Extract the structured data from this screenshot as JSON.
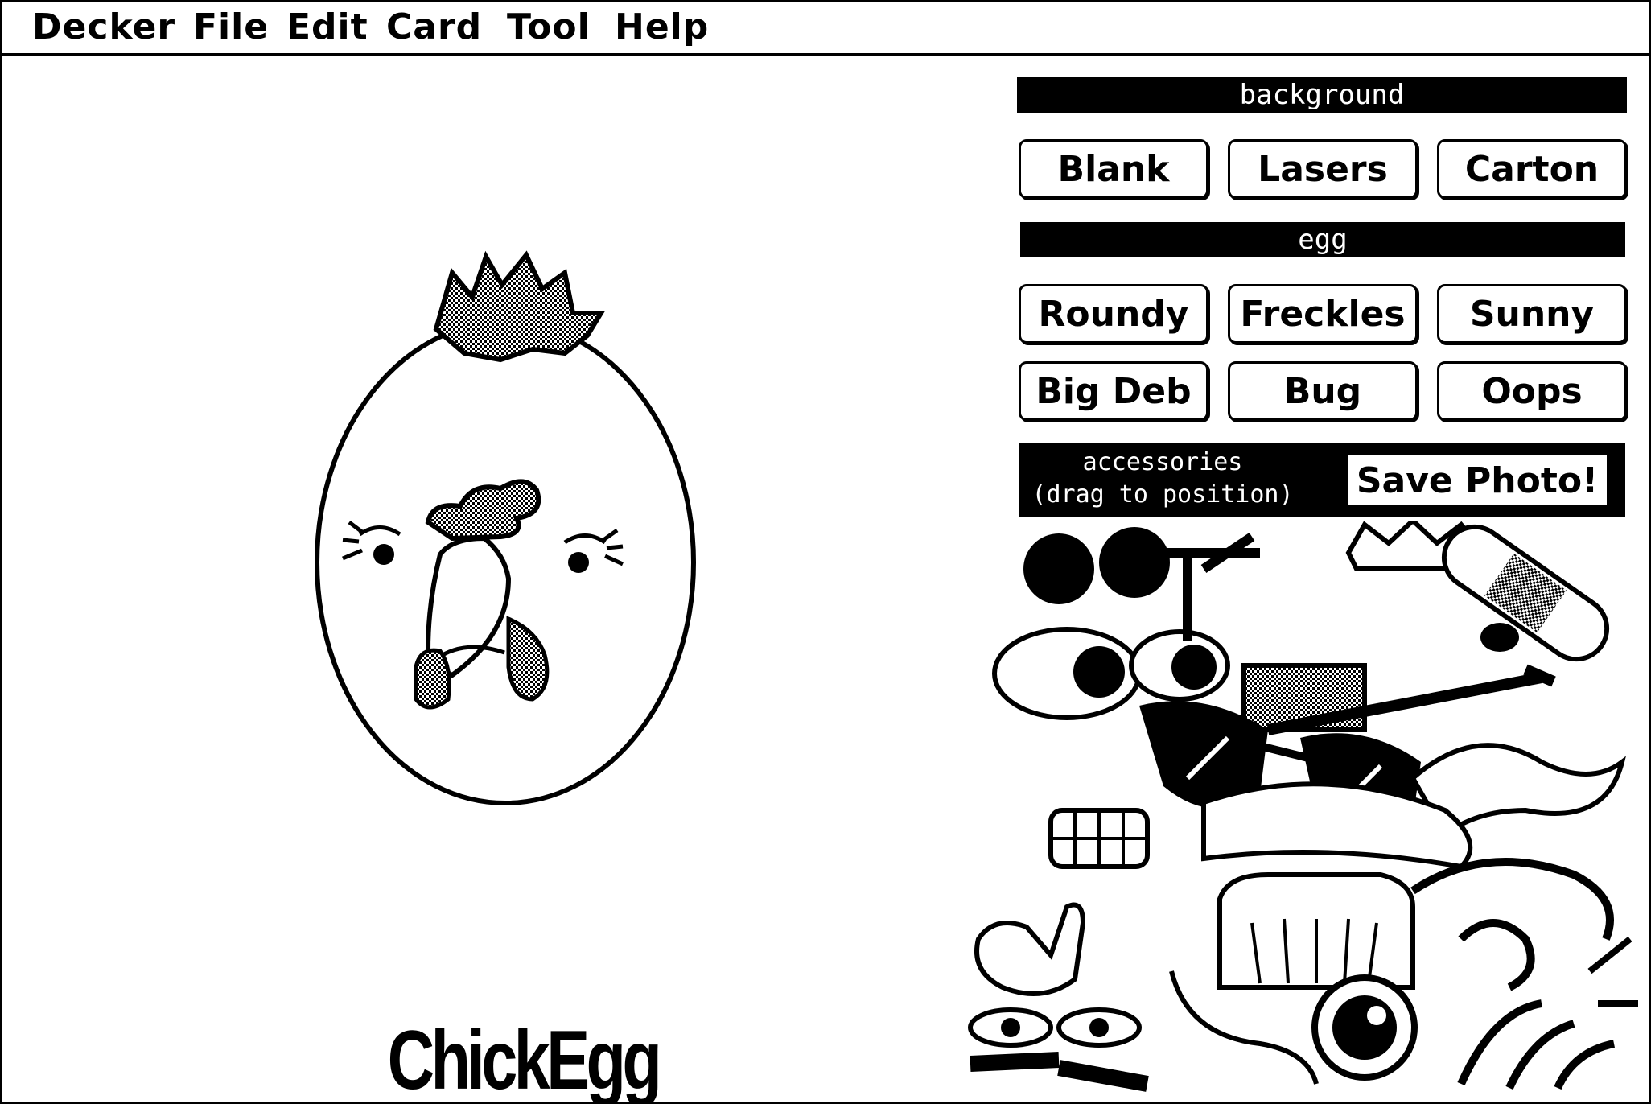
{
  "menubar": {
    "items": [
      "Decker",
      "File",
      "Edit",
      "Card",
      "Tool",
      "Help"
    ]
  },
  "stage": {
    "caption": "ChickEgg"
  },
  "panel": {
    "background_header": "background",
    "background_buttons": [
      "Blank",
      "Lasers",
      "Carton"
    ],
    "egg_header": "egg",
    "egg_buttons": [
      "Roundy",
      "Freckles",
      "Sunny",
      "Big Deb",
      "Bug",
      "Oops"
    ],
    "accessories_label_line1": "accessories",
    "accessories_label_line2": "(drag to position)",
    "save_button": "Save Photo!"
  }
}
